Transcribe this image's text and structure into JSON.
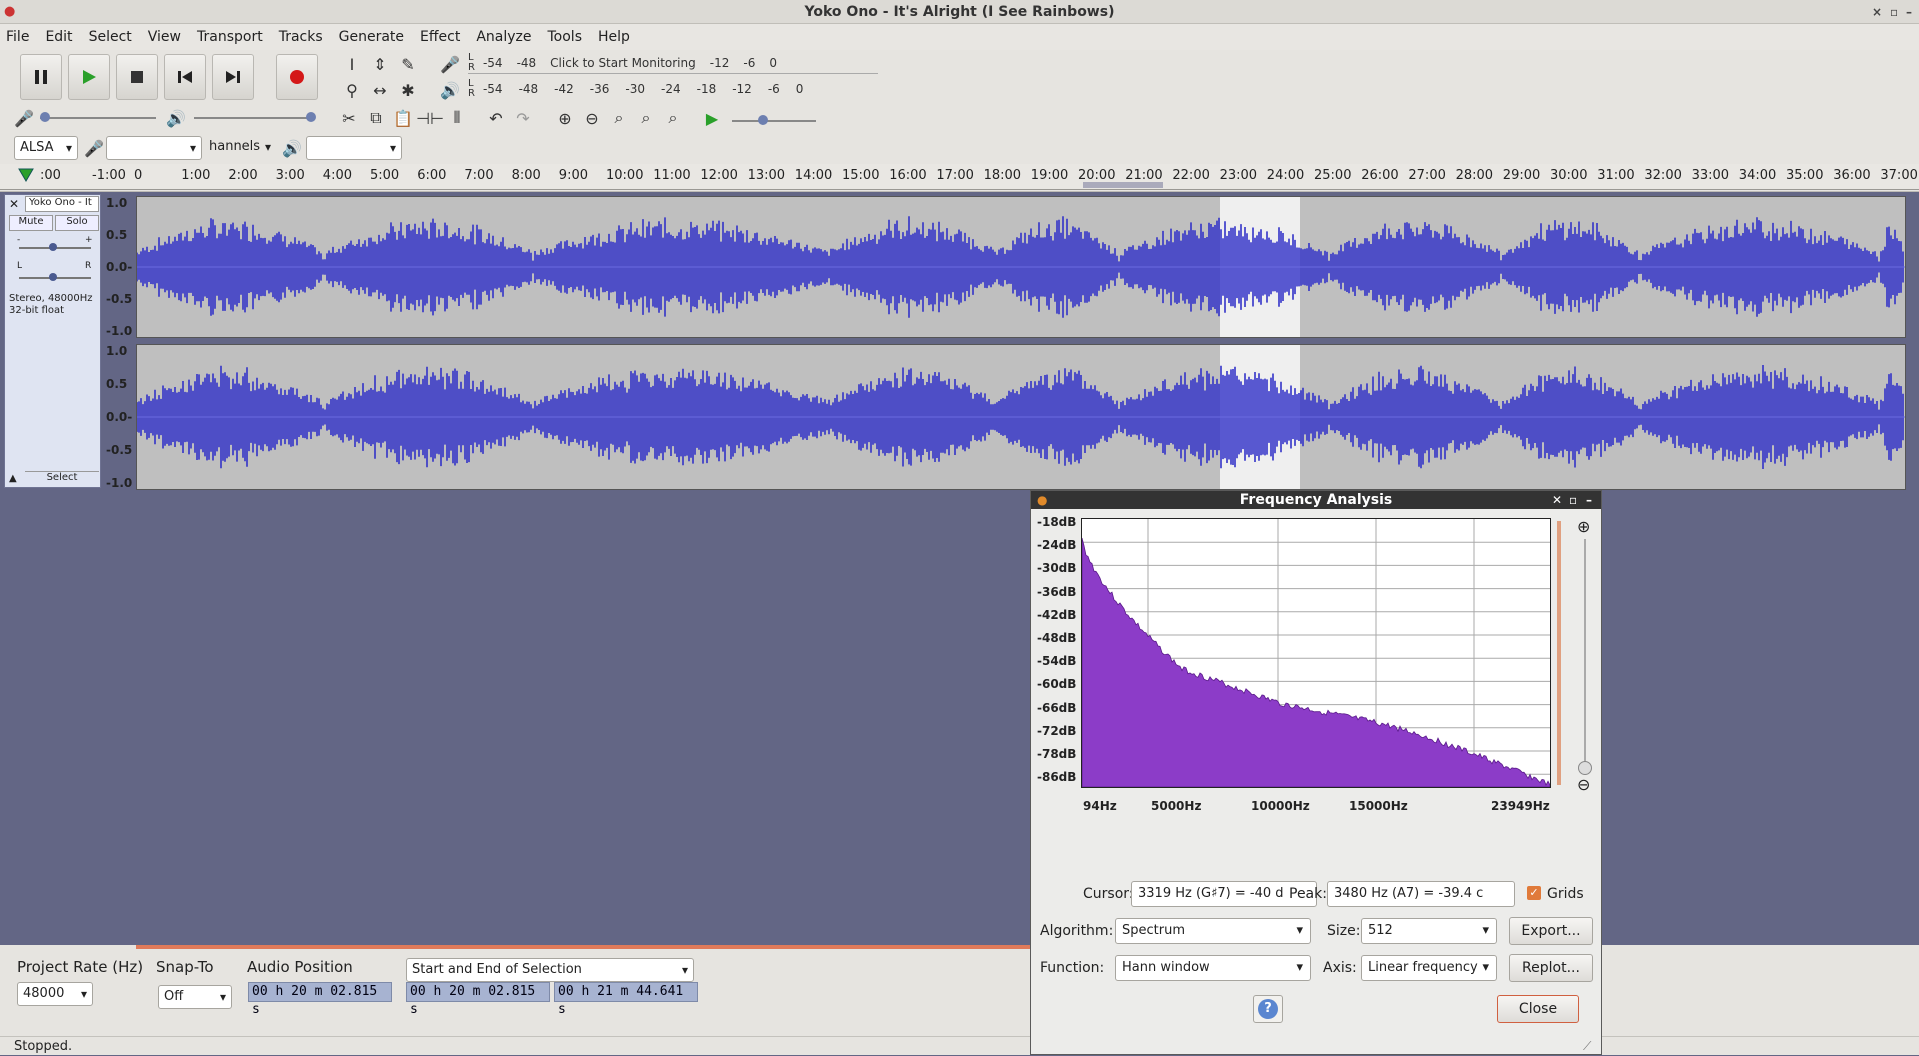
{
  "window": {
    "title": "Yoko Ono - It's Alright (I See Rainbows)"
  },
  "menu": [
    "File",
    "Edit",
    "Select",
    "View",
    "Transport",
    "Tracks",
    "Generate",
    "Effect",
    "Analyze",
    "Tools",
    "Help"
  ],
  "meters": {
    "record_label": "Click to Start Monitoring",
    "record_ticks_left": [
      "-54",
      "-48"
    ],
    "record_ticks_right": [
      "-12",
      "-6",
      "0"
    ],
    "play_ticks": [
      "-54",
      "-48",
      "-42",
      "-36",
      "-30",
      "-24",
      "-18",
      "-12",
      "-6",
      "0"
    ]
  },
  "device": {
    "host": "ALSA",
    "channels": "hannels"
  },
  "ruler": {
    "left_ticks": [
      ":00",
      "-1:00"
    ],
    "ticks": [
      "0",
      "1:00",
      "2:00",
      "3:00",
      "4:00",
      "5:00",
      "6:00",
      "7:00",
      "8:00",
      "9:00",
      "10:00",
      "11:00",
      "12:00",
      "13:00",
      "14:00",
      "15:00",
      "16:00",
      "17:00",
      "18:00",
      "19:00",
      "20:00",
      "21:00",
      "22:00",
      "23:00",
      "24:00",
      "25:00",
      "26:00",
      "27:00",
      "28:00",
      "29:00",
      "30:00",
      "31:00",
      "32:00",
      "33:00",
      "34:00",
      "35:00",
      "36:00",
      "37:00"
    ]
  },
  "track": {
    "name": "Yoko Ono - It",
    "mute": "Mute",
    "solo": "Solo",
    "info1": "Stereo, 48000Hz",
    "info2": "32-bit float",
    "select": "Select",
    "gain_minus": "-",
    "gain_plus": "+",
    "pan_l": "L",
    "pan_r": "R",
    "yaxis": [
      "1.0",
      "0.5",
      "0.0-",
      "-0.5",
      "-1.0"
    ]
  },
  "selection": {
    "project_rate_label": "Project Rate (Hz)",
    "project_rate": "48000",
    "snap_label": "Snap-To",
    "snap_value": "Off",
    "audio_position_label": "Audio Position",
    "selection_mode": "Start and End of Selection",
    "audio_position": "00 h 20 m 02.815 s",
    "sel_start": "00 h 20 m 02.815 s",
    "sel_end": "00 h 21 m 44.641 s"
  },
  "status": "Stopped.",
  "dialog": {
    "title": "Frequency Analysis",
    "db_labels": [
      "-18dB",
      "-24dB",
      "-30dB",
      "-36dB",
      "-42dB",
      "-48dB",
      "-54dB",
      "-60dB",
      "-66dB",
      "-72dB",
      "-78dB",
      "-86dB"
    ],
    "hz_labels": [
      "94Hz",
      "5000Hz",
      "10000Hz",
      "15000Hz",
      "23949Hz"
    ],
    "cursor_label": "Cursor:",
    "cursor_value": "3319 Hz (G♯7) = -40 d",
    "peak_label": "Peak:",
    "peak_value": "3480 Hz (A7) = -39.4 c",
    "grids_label": "Grids",
    "algorithm_label": "Algorithm:",
    "algorithm_value": "Spectrum",
    "size_label": "Size:",
    "size_value": "512",
    "export_label": "Export...",
    "function_label": "Function:",
    "function_value": "Hann window",
    "axis_label": "Axis:",
    "axis_value": "Linear frequency",
    "replot_label": "Replot...",
    "help_label": "?",
    "close_label": "Close"
  },
  "colors": {
    "waveform": "#3232c8",
    "spectrum": "#8c3cc8",
    "background": "#636685"
  }
}
